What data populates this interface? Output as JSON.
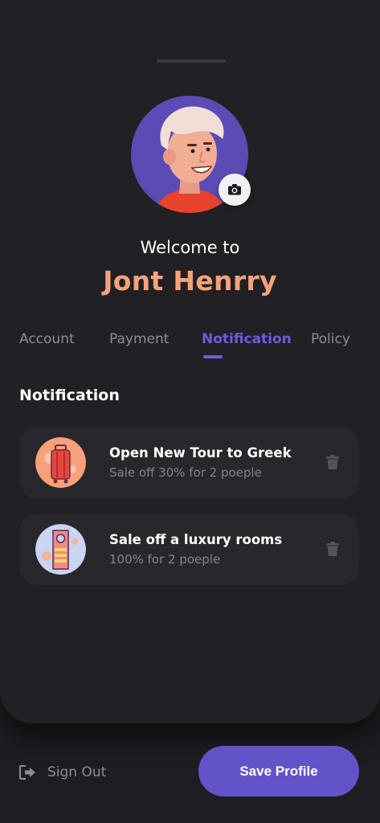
{
  "header": {
    "welcome_text": "Welcome to",
    "user_name": "Jont Henrry"
  },
  "tabs": [
    {
      "label": "Account",
      "active": false
    },
    {
      "label": "Payment",
      "active": false
    },
    {
      "label": "Notification",
      "active": true
    },
    {
      "label": "Policy",
      "active": false
    }
  ],
  "section": {
    "title": "Notification"
  },
  "notifications": [
    {
      "title": "Open New Tour to Greek",
      "subtitle": "Sale off 30% for 2 poeple",
      "icon": "luggage-icon"
    },
    {
      "title": "Sale off a luxury rooms",
      "subtitle": "100% for 2 poeple",
      "icon": "door-hanger-icon"
    }
  ],
  "footer": {
    "sign_out_label": "Sign Out",
    "save_label": "Save Profile"
  },
  "colors": {
    "accent": "#6c5ce0",
    "name": "#f5a27d",
    "background": "#1e1d22",
    "card": "#28272c"
  }
}
